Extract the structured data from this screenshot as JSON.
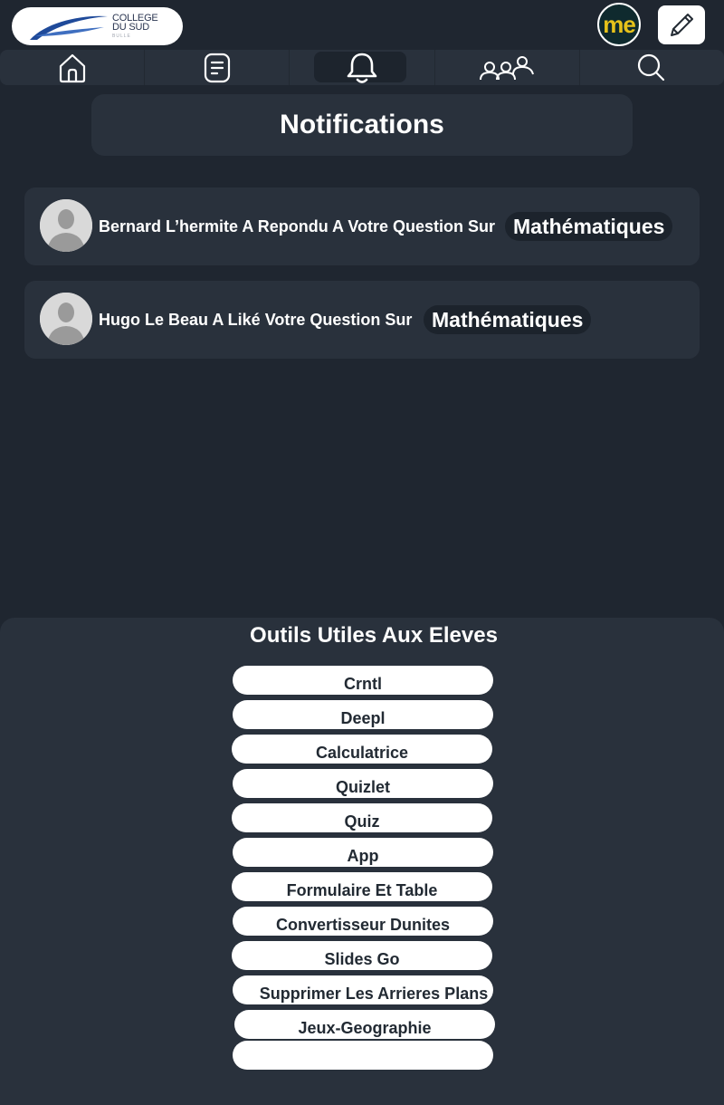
{
  "header": {
    "logo_line1": "COLLEGE",
    "logo_line2": "DU SUD",
    "logo_sub": "BULLE",
    "profile_badge": "me",
    "compose_icon": "pencil-icon"
  },
  "nav": {
    "items": [
      {
        "icon": "home-icon",
        "active": false
      },
      {
        "icon": "document-icon",
        "active": false
      },
      {
        "icon": "bell-icon",
        "active": true
      },
      {
        "icon": "people-icon",
        "active": false
      },
      {
        "icon": "search-icon",
        "active": false
      }
    ]
  },
  "page": {
    "title": "Notifications"
  },
  "notifications": [
    {
      "message": "Bernard L’hermite A Repondu A Votre Question Sur",
      "subject": "Mathématiques"
    },
    {
      "message": "Hugo Le Beau A Liké Votre Question Sur",
      "subject": "Mathématiques"
    }
  ],
  "tools": {
    "title": "Outils Utiles Aux Eleves",
    "items": [
      "Crntl",
      "Deepl",
      "Calculatrice",
      "Quizlet",
      "Quiz",
      "App",
      "Formulaire Et Table",
      "Convertisseur Dunites",
      "Slides Go",
      "Supprimer Les Arrieres Plans",
      "Jeux-Geographie",
      ""
    ]
  },
  "colors": {
    "background": "#1f2630",
    "panel": "#29313c",
    "subject_pill": "#1c232c",
    "me_badge": "#e6c21a",
    "logo_swoosh": "#1f4a9a"
  }
}
